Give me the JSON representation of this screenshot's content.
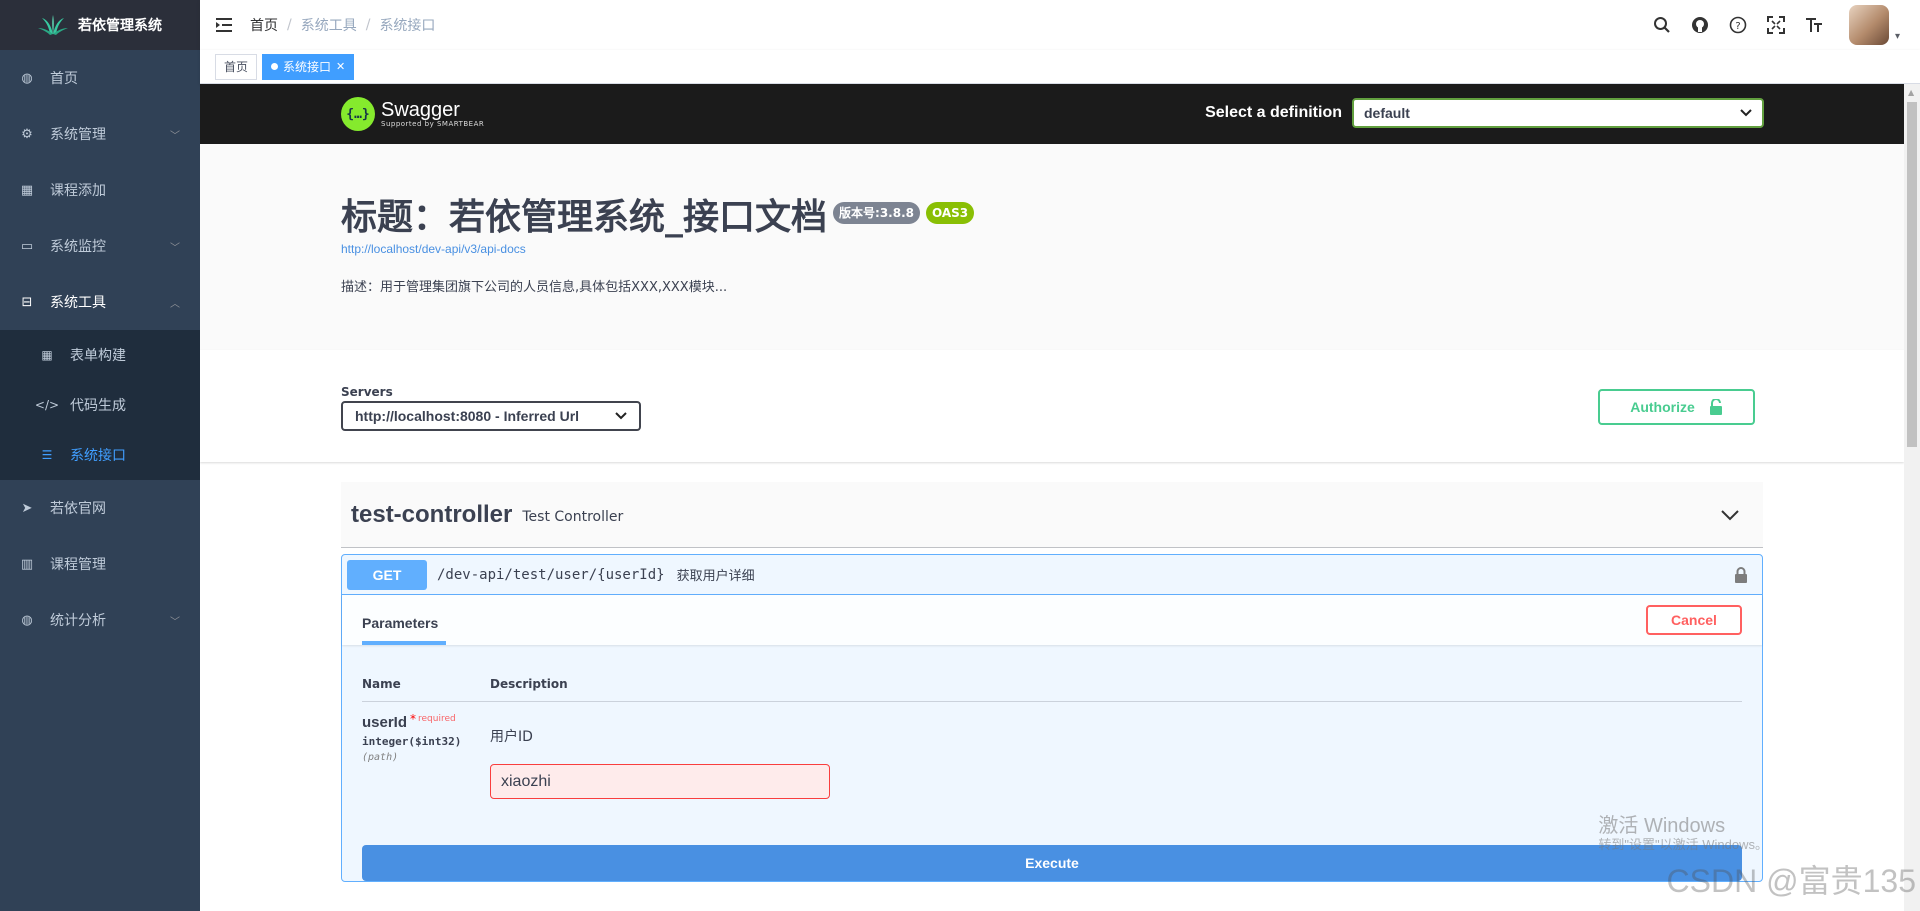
{
  "app": {
    "title": "若依管理系统"
  },
  "sidebar": {
    "items": [
      {
        "label": "首页",
        "icon": "dashboard-icon",
        "glyph": "◍",
        "arrow": ""
      },
      {
        "label": "系统管理",
        "icon": "gear-icon",
        "glyph": "⚙",
        "arrow": "﹀"
      },
      {
        "label": "课程添加",
        "icon": "table-icon",
        "glyph": "▦",
        "arrow": ""
      },
      {
        "label": "系统监控",
        "icon": "monitor-icon",
        "glyph": "▭",
        "arrow": "﹀"
      },
      {
        "label": "系统工具",
        "icon": "toolbox-icon",
        "glyph": "⊟",
        "arrow": "︿"
      },
      {
        "label": "若依官网",
        "icon": "paper-plane-icon",
        "glyph": "➤",
        "arrow": ""
      },
      {
        "label": "课程管理",
        "icon": "book-icon",
        "glyph": "▥",
        "arrow": ""
      },
      {
        "label": "统计分析",
        "icon": "chart-icon",
        "glyph": "◍",
        "arrow": "﹀"
      }
    ],
    "sub_items": [
      {
        "label": "表单构建",
        "icon": "form-icon",
        "glyph": "▦"
      },
      {
        "label": "代码生成",
        "icon": "code-icon",
        "glyph": "</>"
      },
      {
        "label": "系统接口",
        "icon": "api-icon",
        "glyph": "☰"
      }
    ]
  },
  "breadcrumb": [
    "首页",
    "系统工具",
    "系统接口"
  ],
  "tags": [
    {
      "label": "首页",
      "active": false
    },
    {
      "label": "系统接口",
      "active": true
    }
  ],
  "swagger": {
    "logo_title": "Swagger",
    "logo_sub": "Supported by SMARTBEAR",
    "logo_glyph": "{…}",
    "definition_label": "Select a definition",
    "definition_value": "default",
    "info": {
      "title": "标题：若依管理系统_接口文档",
      "version_badge": "版本号:3.8.8",
      "oas_badge": "OAS3",
      "url": "http://localhost/dev-api/v3/api-docs",
      "description": "描述：用于管理集团旗下公司的人员信息,具体包括XXX,XXX模块..."
    },
    "servers_label": "Servers",
    "server_value": "http://localhost:8080 - Inferred Url",
    "authorize_label": "Authorize",
    "tag": {
      "name": "test-controller",
      "description": "Test Controller"
    },
    "operation": {
      "method": "GET",
      "path": "/dev-api/test/user/{userId}",
      "summary": "获取用户详细",
      "parameters_tab": "Parameters",
      "cancel_label": "Cancel",
      "col_name": "Name",
      "col_description": "Description",
      "param": {
        "name": "userId",
        "required_star": "*",
        "required_text": "required",
        "type": "integer($int32)",
        "in": "(path)",
        "description": "用户ID",
        "value": "xiaozhi"
      },
      "execute_label": "Execute"
    }
  },
  "overlay": {
    "activation_title": "激活 Windows",
    "activation_sub": "转到\"设置\"以激活 Windows。",
    "csdn": "CSDN @富贵135"
  },
  "colors": {
    "sidebar_bg": "#304156",
    "active_blue": "#409eff",
    "get_blue": "#61affe",
    "authorize_green": "#49cc90",
    "cancel_red": "#ff6060",
    "execute_blue": "#4990e2"
  }
}
